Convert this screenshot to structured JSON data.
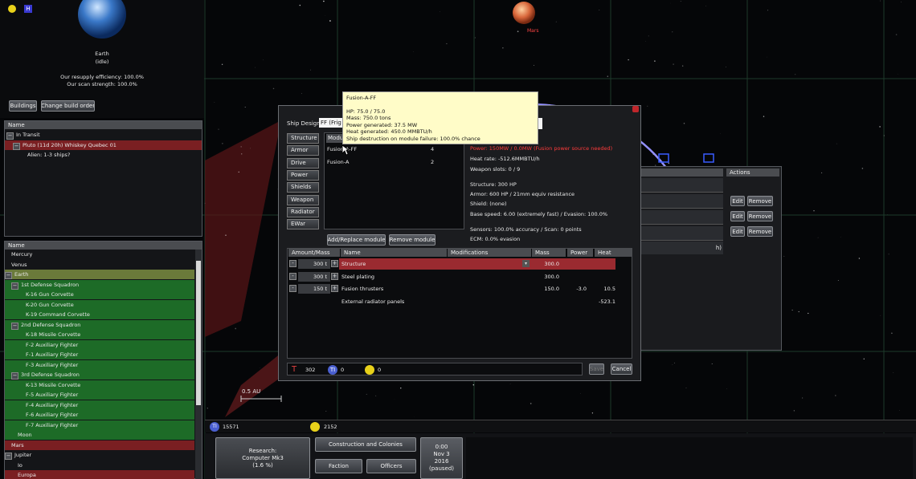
{
  "colors": {
    "accent_red": "#8a2327",
    "accent_green": "#1d6b27",
    "orbit": "#8a88ff",
    "warning": "#ff3b3b"
  },
  "map": {
    "mars_label": "Mars",
    "scale_label": "0.5 AU"
  },
  "earth_panel": {
    "name": "Earth",
    "state": "(idle)",
    "resupply": "Our resupply efficiency: 100.0%",
    "scan": "Our scan strength: 100.0%",
    "buildings_btn": "Buildings",
    "change_btn": "Change build order"
  },
  "transit_panel": {
    "header": "Name",
    "group": "In Transit",
    "fleet": "Pluto (11d 20h) Whiskey Quebec 01",
    "alien": "Alien: 1-3 ships?"
  },
  "tree": {
    "header": "Name",
    "items": [
      {
        "label": "Mercury",
        "style": "plain"
      },
      {
        "label": "Venus",
        "style": "plain"
      },
      {
        "label": "Earth",
        "style": "olive"
      },
      {
        "label": "1st Defense Squadron",
        "style": "green"
      },
      {
        "label": "K-16 Gun Corvette",
        "style": "green"
      },
      {
        "label": "K-20 Gun Corvette",
        "style": "green"
      },
      {
        "label": "K-19 Command Corvette",
        "style": "green"
      },
      {
        "label": "2nd Defense Squadron",
        "style": "green"
      },
      {
        "label": "K-18 Missile Corvette",
        "style": "green"
      },
      {
        "label": "F-2 Auxiliary Fighter",
        "style": "green"
      },
      {
        "label": "F-1 Auxiliary Fighter",
        "style": "green"
      },
      {
        "label": "F-3 Auxiliary Fighter",
        "style": "green"
      },
      {
        "label": "3rd Defense Squadron",
        "style": "green"
      },
      {
        "label": "K-13 Missile Corvette",
        "style": "green"
      },
      {
        "label": "F-5 Auxiliary Fighter",
        "style": "green"
      },
      {
        "label": "F-4 Auxiliary Fighter",
        "style": "green"
      },
      {
        "label": "F-6 Auxiliary Fighter",
        "style": "green"
      },
      {
        "label": "F-7 Auxiliary Fighter",
        "style": "green"
      },
      {
        "label": "Moon",
        "style": "green"
      },
      {
        "label": "Mars",
        "style": "red"
      },
      {
        "label": "Jupiter",
        "style": "plain"
      },
      {
        "label": "Io",
        "style": "plain"
      },
      {
        "label": "Europa",
        "style": "red"
      }
    ]
  },
  "ship_design": {
    "label": "Ship Design",
    "design_value": "FF (Frig",
    "categories": [
      "Structure",
      "Armor",
      "Drive",
      "Power",
      "Shields",
      "Weapon",
      "Radiator",
      "EWar"
    ],
    "module_header": "Modu",
    "modules": [
      {
        "name": "Fusion-A-FF",
        "count": "4"
      },
      {
        "name": "Fusion-A",
        "count": "2"
      }
    ],
    "warning": "Power: 150MW / 0.0MW (Fusion power source needed)",
    "heat_rate": "Heat rate: -512.6MMBTU/h",
    "weapon_slots": "Weapon slots: 0 / 9",
    "structure": "Structure: 300 HP",
    "armor": "Armor: 600 HP / 21mm equiv resistance",
    "shield": "Shield: (none)",
    "base_speed": "Base speed: 6.00 (extremely fast) / Evasion: 100.0%",
    "sensors": "Sensors: 100.0% accuracy / Scan: 0 points",
    "ecm": "ECM: 0.0% evasion",
    "add_btn": "Add/Replace module",
    "remove_btn": "Remove module",
    "table_headers": [
      "Amount/Mass",
      "Name",
      "Modifications",
      "Mass",
      "Power",
      "Heat"
    ],
    "rows": [
      {
        "amount": "300 t",
        "name": "Structure",
        "mass": "300.0",
        "power": "",
        "heat": "",
        "has_amount": true
      },
      {
        "amount": "300 t",
        "name": "Steel plating",
        "mass": "300.0",
        "power": "",
        "heat": "",
        "has_amount": true
      },
      {
        "amount": "150 t",
        "name": "Fusion thrusters",
        "mass": "150.0",
        "power": "-3.0",
        "heat": "10.5",
        "has_amount": true
      },
      {
        "amount": "",
        "name": "External radiator panels",
        "mass": "",
        "power": "",
        "heat": "-523.1",
        "has_amount": false
      }
    ],
    "cost_1": "302",
    "cost_2": "0",
    "cost_3": "0",
    "save_btn": "Save",
    "cancel_btn": "Cancel"
  },
  "tooltip": {
    "title": "Fusion-A-FF",
    "hp": "HP: 75.0 / 75.0",
    "mass": "Mass: 750.0 tons",
    "power": "Power generated: 37.5 MW",
    "heat": "Heat generated: 450.0 MMBTU/h",
    "destruction": "Ship destruction on module failure: 100.0% chance"
  },
  "actions_panel": {
    "header": "Actions",
    "edit": "Edit",
    "remove": "Remove",
    "partial": "h)"
  },
  "resources": {
    "credits": "15571",
    "energy": "2152"
  },
  "bottom": {
    "research_title": "Research:",
    "research_item": "Computer Mk3",
    "research_pct": "(1.6 %)",
    "construction_btn": "Construction and Colonies",
    "faction_btn": "Faction",
    "officers_btn": "Officers",
    "time": "0:00",
    "date": "Nov 3",
    "year": "2016",
    "status": "(paused)"
  }
}
